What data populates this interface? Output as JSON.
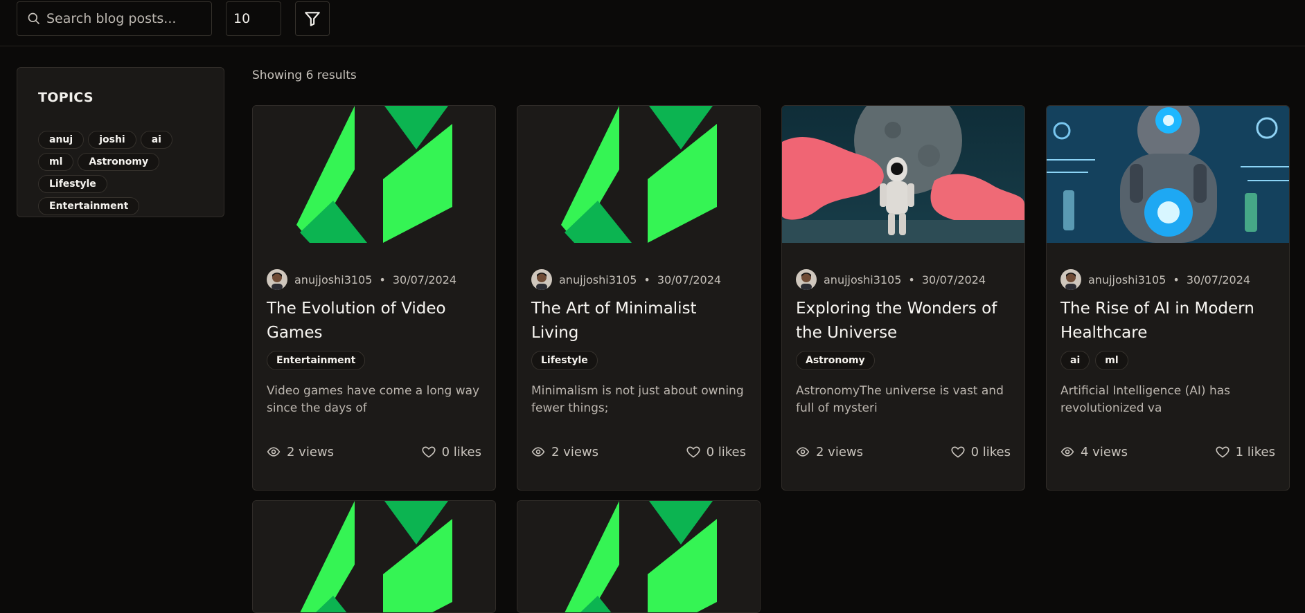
{
  "search": {
    "placeholder": "Search blog posts...",
    "value": ""
  },
  "page_size": {
    "value": "10"
  },
  "filter": {
    "icon": "filter-icon"
  },
  "topics": {
    "title": "TOPICS",
    "items": [
      "anuj",
      "joshi",
      "ai",
      "ml",
      "Astronomy",
      "Lifestyle",
      "Entertainment"
    ]
  },
  "results_text": "Showing 6 results",
  "posts": [
    {
      "author": "anujjoshi3105",
      "date": "30/07/2024",
      "title": "The Evolution of Video Games",
      "tags": [
        "Entertainment"
      ],
      "excerpt": "Video games have come a long way since the days of",
      "views": "2 views",
      "likes": "0 likes",
      "image": "green-logo"
    },
    {
      "author": "anujjoshi3105",
      "date": "30/07/2024",
      "title": "The Art of Minimalist Living",
      "tags": [
        "Lifestyle"
      ],
      "excerpt": "Minimalism is not just about owning fewer things;",
      "views": "2 views",
      "likes": "0 likes",
      "image": "green-logo"
    },
    {
      "author": "anujjoshi3105",
      "date": "30/07/2024",
      "title": "Exploring the Wonders of the Universe",
      "tags": [
        "Astronomy"
      ],
      "excerpt": "AstronomyThe universe is vast and full of mysteri",
      "views": "2 views",
      "likes": "0 likes",
      "image": "astronaut-photo"
    },
    {
      "author": "anujjoshi3105",
      "date": "30/07/2024",
      "title": "The Rise of AI in Modern Healthcare",
      "tags": [
        "ai",
        "ml"
      ],
      "excerpt": "Artificial Intelligence (AI) has revolutionized va",
      "views": "4 views",
      "likes": "1 likes",
      "image": "robot-photo"
    },
    {
      "image": "green-logo"
    },
    {
      "image": "green-logo"
    }
  ],
  "colors": {
    "background": "#0b0a09",
    "card": "#1c1a18",
    "logo_green_light": "#35f454",
    "logo_green_dark": "#0cb451"
  }
}
